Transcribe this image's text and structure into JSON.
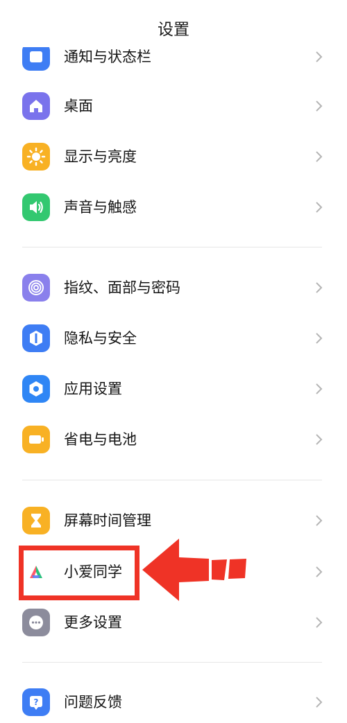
{
  "header": {
    "title": "设置"
  },
  "sections": [
    {
      "items": [
        {
          "label": "通知与状态栏",
          "icon": "notification-icon",
          "color": "#3e7df4"
        },
        {
          "label": "桌面",
          "icon": "home-icon",
          "color": "#7a73ec"
        },
        {
          "label": "显示与亮度",
          "icon": "sun-icon",
          "color": "#f8b124"
        },
        {
          "label": "声音与触感",
          "icon": "speaker-icon",
          "color": "#33c870"
        }
      ]
    },
    {
      "items": [
        {
          "label": "指纹、面部与密码",
          "icon": "fingerprint-icon",
          "color": "#8a80ec"
        },
        {
          "label": "隐私与安全",
          "icon": "shield-icon",
          "color": "#3e7df4"
        },
        {
          "label": "应用设置",
          "icon": "hexagon-gear-icon",
          "color": "#2f86f5"
        },
        {
          "label": "省电与电池",
          "icon": "battery-icon",
          "color": "#f8b124"
        }
      ]
    },
    {
      "items": [
        {
          "label": "屏幕时间管理",
          "icon": "hourglass-icon",
          "color": "#f8b124"
        },
        {
          "label": "小爱同学",
          "icon": "xiaoai-icon",
          "color": "#ffffff"
        },
        {
          "label": "更多设置",
          "icon": "more-dots-icon",
          "color": "#8c8c9c"
        }
      ]
    },
    {
      "items": [
        {
          "label": "问题反馈",
          "icon": "help-icon",
          "color": "#3e7df4"
        }
      ]
    }
  ],
  "annotation": {
    "highlight_color": "#ef3326",
    "target": "小爱同学"
  }
}
